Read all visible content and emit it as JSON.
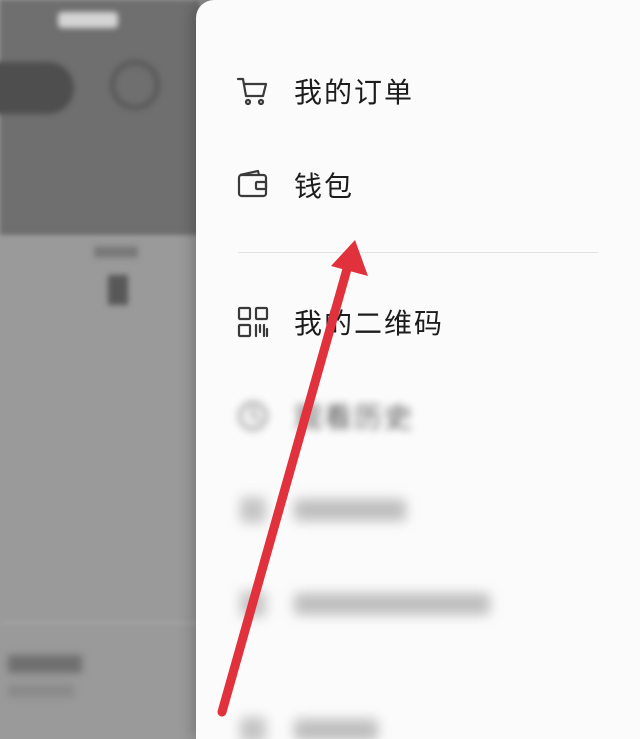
{
  "menu": {
    "items": [
      {
        "label": "我的订单",
        "icon": "cart-icon"
      },
      {
        "label": "钱包",
        "icon": "wallet-icon"
      },
      {
        "label": "我的二维码",
        "icon": "qr-code-icon"
      },
      {
        "label": "观看历史",
        "icon": "clock-icon"
      }
    ]
  },
  "colors": {
    "annotation_arrow": "#e0313c",
    "drawer_background": "#fbfbfb",
    "text": "#1c1c1c"
  }
}
